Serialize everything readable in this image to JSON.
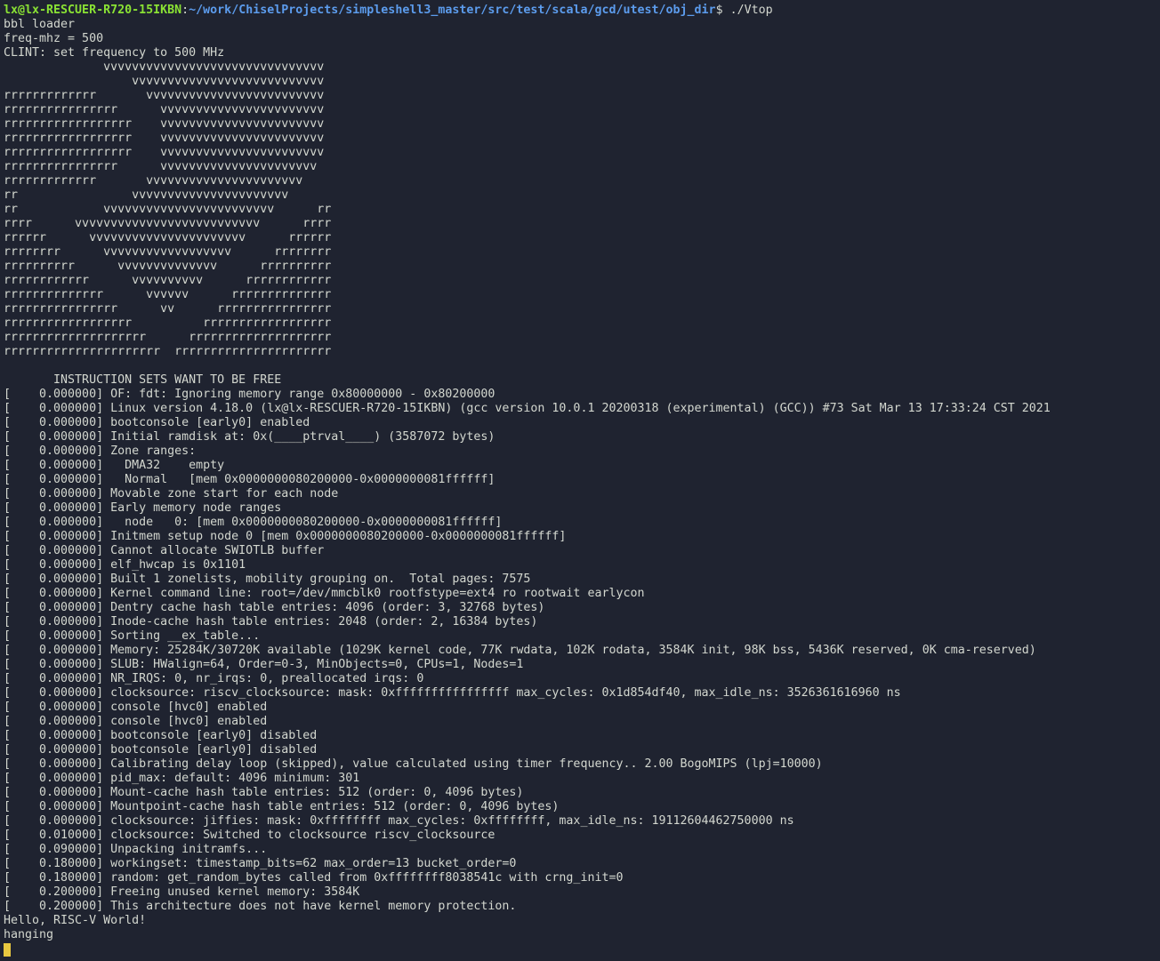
{
  "prompt": {
    "user_host": "lx@lx-RESCUER-R720-15IKBN",
    "separator": ":",
    "path": "~/work/ChiselProjects/simpleshell3_master/src/test/scala/gcd/utest/obj_dir",
    "symbol": "$",
    "command": " ./Vtop"
  },
  "output_lines": [
    "bbl loader",
    "freq-mhz = 500",
    "CLINT: set frequency to 500 MHz",
    "              vvvvvvvvvvvvvvvvvvvvvvvvvvvvvvv",
    "                  vvvvvvvvvvvvvvvvvvvvvvvvvvv",
    "rrrrrrrrrrrrr       vvvvvvvvvvvvvvvvvvvvvvvvv",
    "rrrrrrrrrrrrrrrr      vvvvvvvvvvvvvvvvvvvvvvv",
    "rrrrrrrrrrrrrrrrrr    vvvvvvvvvvvvvvvvvvvvvvv",
    "rrrrrrrrrrrrrrrrrr    vvvvvvvvvvvvvvvvvvvvvvv",
    "rrrrrrrrrrrrrrrrrr    vvvvvvvvvvvvvvvvvvvvvvv",
    "rrrrrrrrrrrrrrrr      vvvvvvvvvvvvvvvvvvvvvv",
    "rrrrrrrrrrrrr       vvvvvvvvvvvvvvvvvvvvvv",
    "rr                vvvvvvvvvvvvvvvvvvvvvv",
    "rr            vvvvvvvvvvvvvvvvvvvvvvvv      rr",
    "rrrr      vvvvvvvvvvvvvvvvvvvvvvvvvv      rrrr",
    "rrrrrr      vvvvvvvvvvvvvvvvvvvvvv      rrrrrr",
    "rrrrrrrr      vvvvvvvvvvvvvvvvvv      rrrrrrrr",
    "rrrrrrrrrr      vvvvvvvvvvvvvv      rrrrrrrrrr",
    "rrrrrrrrrrrr      vvvvvvvvvv      rrrrrrrrrrrr",
    "rrrrrrrrrrrrrr      vvvvvv      rrrrrrrrrrrrrr",
    "rrrrrrrrrrrrrrrr      vv      rrrrrrrrrrrrrrrr",
    "rrrrrrrrrrrrrrrrrr          rrrrrrrrrrrrrrrrrr",
    "rrrrrrrrrrrrrrrrrrrr      rrrrrrrrrrrrrrrrrrrr",
    "rrrrrrrrrrrrrrrrrrrrrr  rrrrrrrrrrrrrrrrrrrrrr",
    "",
    "       INSTRUCTION SETS WANT TO BE FREE",
    "[    0.000000] OF: fdt: Ignoring memory range 0x80000000 - 0x80200000",
    "[    0.000000] Linux version 4.18.0 (lx@lx-RESCUER-R720-15IKBN) (gcc version 10.0.1 20200318 (experimental) (GCC)) #73 Sat Mar 13 17:33:24 CST 2021",
    "[    0.000000] bootconsole [early0] enabled",
    "[    0.000000] Initial ramdisk at: 0x(____ptrval____) (3587072 bytes)",
    "[    0.000000] Zone ranges:",
    "[    0.000000]   DMA32    empty",
    "[    0.000000]   Normal   [mem 0x0000000080200000-0x0000000081ffffff]",
    "[    0.000000] Movable zone start for each node",
    "[    0.000000] Early memory node ranges",
    "[    0.000000]   node   0: [mem 0x0000000080200000-0x0000000081ffffff]",
    "[    0.000000] Initmem setup node 0 [mem 0x0000000080200000-0x0000000081ffffff]",
    "[    0.000000] Cannot allocate SWIOTLB buffer",
    "[    0.000000] elf_hwcap is 0x1101",
    "[    0.000000] Built 1 zonelists, mobility grouping on.  Total pages: 7575",
    "[    0.000000] Kernel command line: root=/dev/mmcblk0 rootfstype=ext4 ro rootwait earlycon",
    "[    0.000000] Dentry cache hash table entries: 4096 (order: 3, 32768 bytes)",
    "[    0.000000] Inode-cache hash table entries: 2048 (order: 2, 16384 bytes)",
    "[    0.000000] Sorting __ex_table...",
    "[    0.000000] Memory: 25284K/30720K available (1029K kernel code, 77K rwdata, 102K rodata, 3584K init, 98K bss, 5436K reserved, 0K cma-reserved)",
    "[    0.000000] SLUB: HWalign=64, Order=0-3, MinObjects=0, CPUs=1, Nodes=1",
    "[    0.000000] NR_IRQS: 0, nr_irqs: 0, preallocated irqs: 0",
    "[    0.000000] clocksource: riscv_clocksource: mask: 0xffffffffffffffff max_cycles: 0x1d854df40, max_idle_ns: 3526361616960 ns",
    "[    0.000000] console [hvc0] enabled",
    "[    0.000000] console [hvc0] enabled",
    "[    0.000000] bootconsole [early0] disabled",
    "[    0.000000] bootconsole [early0] disabled",
    "[    0.000000] Calibrating delay loop (skipped), value calculated using timer frequency.. 2.00 BogoMIPS (lpj=10000)",
    "[    0.000000] pid_max: default: 4096 minimum: 301",
    "[    0.000000] Mount-cache hash table entries: 512 (order: 0, 4096 bytes)",
    "[    0.000000] Mountpoint-cache hash table entries: 512 (order: 0, 4096 bytes)",
    "[    0.000000] clocksource: jiffies: mask: 0xffffffff max_cycles: 0xffffffff, max_idle_ns: 19112604462750000 ns",
    "[    0.010000] clocksource: Switched to clocksource riscv_clocksource",
    "[    0.090000] Unpacking initramfs...",
    "[    0.180000] workingset: timestamp_bits=62 max_order=13 bucket_order=0",
    "[    0.180000] random: get_random_bytes called from 0xffffffff8038541c with crng_init=0",
    "[    0.200000] Freeing unused kernel memory: 3584K",
    "[    0.200000] This architecture does not have kernel memory protection.",
    "Hello, RISC-V World!",
    "hanging"
  ],
  "colors": {
    "background": "#1f2330",
    "text": "#d3d7cf",
    "prompt_user": "#8ae234",
    "prompt_path": "#5c9ced",
    "cursor": "#e8c840"
  }
}
